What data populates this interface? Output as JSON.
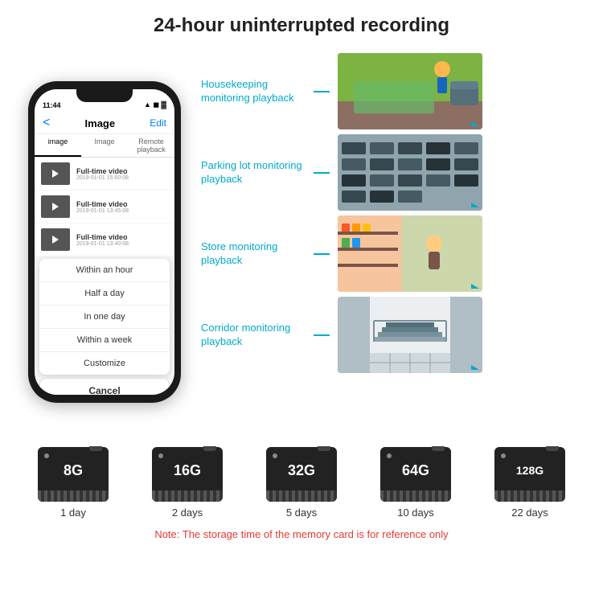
{
  "header": {
    "title": "24-hour uninterrupted recording"
  },
  "phone": {
    "status_time": "11:44",
    "nav_back": "<",
    "nav_title": "Image",
    "nav_edit": "Edit",
    "tabs": [
      "image",
      "Image",
      "Remote playback"
    ],
    "list_items": [
      {
        "title": "Full-time video",
        "date": "2019-01-01 15:60:08"
      },
      {
        "title": "Full-time video",
        "date": "2019-01-01 13:45:08"
      },
      {
        "title": "Full-time video",
        "date": "2019-01-01 13:40:08"
      }
    ],
    "dropdown_items": [
      "Within an hour",
      "Half a day",
      "In one day",
      "Within a week",
      "Customize"
    ],
    "cancel_label": "Cancel"
  },
  "monitoring": [
    {
      "label": "Housekeeping monitoring playback",
      "img_class": "img-housekeeping"
    },
    {
      "label": "Parking lot monitoring playback",
      "img_class": "img-parking"
    },
    {
      "label": "Store monitoring playback",
      "img_class": "img-store"
    },
    {
      "label": "Corridor monitoring playback",
      "img_class": "img-corridor"
    }
  ],
  "sd_cards": [
    {
      "size": "8G",
      "days": "1 day"
    },
    {
      "size": "16G",
      "days": "2 days"
    },
    {
      "size": "32G",
      "days": "5 days"
    },
    {
      "size": "64G",
      "days": "10 days"
    },
    {
      "size": "128G",
      "days": "22 days"
    }
  ],
  "note": "Note: The storage time of the memory card is for reference only"
}
